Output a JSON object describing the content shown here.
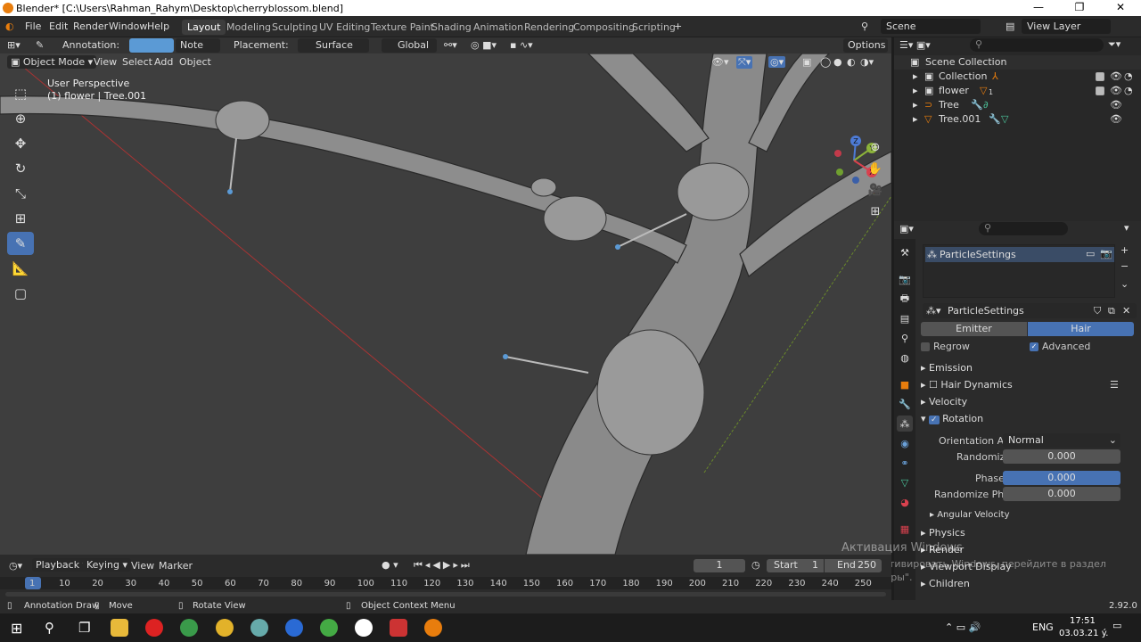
{
  "window": {
    "title": "Blender* [C:\\Users\\Rahman_Rahym\\Desktop\\cherryblossom.blend]",
    "minimize": "—",
    "maximize": "❐",
    "close": "✕"
  },
  "menubar": {
    "menus": [
      "File",
      "Edit",
      "Render",
      "Window",
      "Help"
    ],
    "workspaces": [
      "Layout",
      "Modeling",
      "Sculpting",
      "UV Editing",
      "Texture Paint",
      "Shading",
      "Animation",
      "Rendering",
      "Compositing",
      "Scripting"
    ],
    "active_workspace": "Layout",
    "add_tab": "+",
    "scene": "Scene",
    "view_layer": "View Layer"
  },
  "tool_header": {
    "annotation_label": "Annotation:",
    "annotation_type": "Note",
    "placement_label": "Placement:",
    "placement_value": "Surface",
    "orientation": "Global",
    "options": "Options"
  },
  "viewport": {
    "mode": "Object Mode",
    "menus": [
      "View",
      "Select",
      "Add",
      "Object"
    ],
    "perspective": "User Perspective",
    "object_info": "(1) flower | Tree.001",
    "gizmo_axes": {
      "x": "X",
      "y": "Y",
      "z": "Z"
    }
  },
  "outliner": {
    "root": "Scene Collection",
    "items": [
      {
        "name": "Collection"
      },
      {
        "name": "flower",
        "count": "1"
      },
      {
        "name": "Tree"
      },
      {
        "name": "Tree.001"
      }
    ]
  },
  "properties": {
    "datablock": "ParticleSettings",
    "datablock2": "ParticleSettings",
    "type_tabs": [
      "Emitter",
      "Hair"
    ],
    "active_type": "Hair",
    "regrow": "Regrow",
    "advanced": "Advanced",
    "sections": {
      "emission": "Emission",
      "hair_dynamics": "Hair Dynamics",
      "velocity": "Velocity",
      "rotation": "Rotation",
      "angular_velocity": "Angular Velocity",
      "physics": "Physics",
      "render": "Render",
      "viewport_display": "Viewport Display",
      "children": "Children"
    },
    "rotation": {
      "orientation_axis_label": "Orientation Axis",
      "orientation_axis_value": "Normal",
      "randomize_label": "Randomize",
      "randomize_value": "0.000",
      "phase_label": "Phase",
      "phase_value": "0.000",
      "randomize_phase_label": "Randomize Phase",
      "randomize_phase_value": "0.000"
    }
  },
  "timeline": {
    "menus": [
      "Playback",
      "Keying",
      "View",
      "Marker"
    ],
    "current_frame": "1",
    "start_label": "Start",
    "start_value": "1",
    "end_label": "End",
    "end_value": "250",
    "ruler": [
      "1",
      "10",
      "20",
      "30",
      "40",
      "50",
      "60",
      "70",
      "80",
      "90",
      "100",
      "110",
      "120",
      "130",
      "140",
      "150",
      "160",
      "170",
      "180",
      "190",
      "200",
      "210",
      "220",
      "230",
      "240",
      "250"
    ]
  },
  "statusbar": {
    "left": "Annotation Draw",
    "move": "Move",
    "rotate": "Rotate View",
    "context": "Object Context Menu",
    "version": "2.92.0"
  },
  "watermark": {
    "line1": "Активация Windows",
    "line2": "Чтобы активировать Windows, перейдите в раздел",
    "line3": "\"Параметры\"."
  },
  "taskbar": {
    "lang": "ENG",
    "time": "17:51",
    "date": "03.03.21 ý."
  },
  "colors": {
    "accent": "#4772b3",
    "blender_orange": "#e87d0d",
    "viewport_bg": "#3e3e3e"
  }
}
